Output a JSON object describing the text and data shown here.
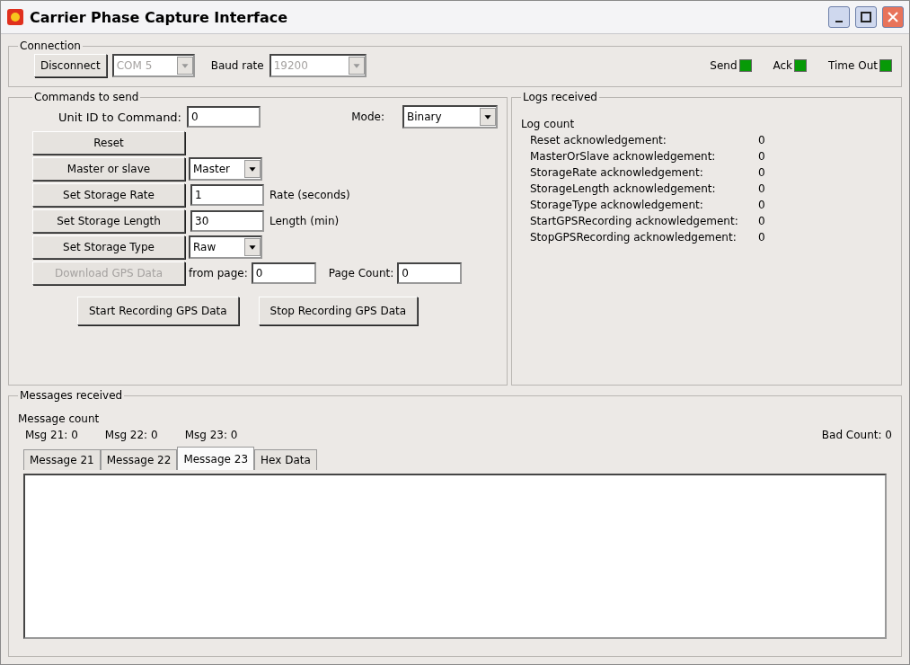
{
  "window": {
    "title": "Carrier Phase Capture Interface"
  },
  "connection": {
    "legend": "Connection",
    "connect_button": {
      "label": "Disconnect"
    },
    "port": {
      "value": "COM 5",
      "disabled": true
    },
    "baud_label": "Baud rate",
    "baud": {
      "value": "19200",
      "disabled": true
    },
    "indicators": [
      {
        "label": "Send",
        "on": true
      },
      {
        "label": "Ack",
        "on": true
      },
      {
        "label": "Time Out",
        "on": true
      }
    ]
  },
  "commands": {
    "legend": "Commands to send",
    "unit_label": "Unit ID to Command:",
    "unit_value": "0",
    "mode_label": "Mode:",
    "mode_value": "Binary",
    "rows": [
      {
        "kind": "button",
        "label": "Reset"
      },
      {
        "kind": "combo",
        "label": "Master or slave",
        "value": "Master"
      },
      {
        "kind": "field",
        "label": "Set Storage Rate",
        "value": "1",
        "note": "Rate (seconds)"
      },
      {
        "kind": "field",
        "label": "Set Storage Length",
        "value": "30",
        "note": "Length (min)"
      },
      {
        "kind": "combo",
        "label": "Set Storage Type",
        "value": "Raw"
      },
      {
        "kind": "download",
        "label": "Download GPS Data",
        "disabled": true,
        "from_label": "from page:",
        "from_value": "0",
        "count_label": "Page Count:",
        "count_value": "0"
      }
    ],
    "actions": [
      "Start Recording GPS Data",
      "Stop Recording GPS Data"
    ]
  },
  "logs": {
    "legend": "Logs received",
    "heading": "Log count",
    "items": [
      {
        "label": "Reset acknowledgement:",
        "count": "0"
      },
      {
        "label": "MasterOrSlave acknowledgement:",
        "count": "0"
      },
      {
        "label": "StorageRate acknowledgement:",
        "count": "0"
      },
      {
        "label": "StorageLength acknowledgement:",
        "count": "0"
      },
      {
        "label": "StorageType acknowledgement:",
        "count": "0"
      },
      {
        "label": "StartGPSRecording acknowledgement:",
        "count": "0"
      },
      {
        "label": "StopGPSRecording acknowledgement:",
        "count": "0"
      }
    ]
  },
  "messages": {
    "legend": "Messages received",
    "heading": "Message count",
    "counts": [
      "Msg 21: 0",
      "Msg 22: 0",
      "Msg 23: 0"
    ],
    "bad_count": "Bad Count: 0",
    "tabs": [
      {
        "label": "Message 21",
        "selected": false
      },
      {
        "label": "Message 22",
        "selected": false
      },
      {
        "label": "Message 23",
        "selected": true
      },
      {
        "label": "Hex Data",
        "selected": false
      }
    ]
  }
}
